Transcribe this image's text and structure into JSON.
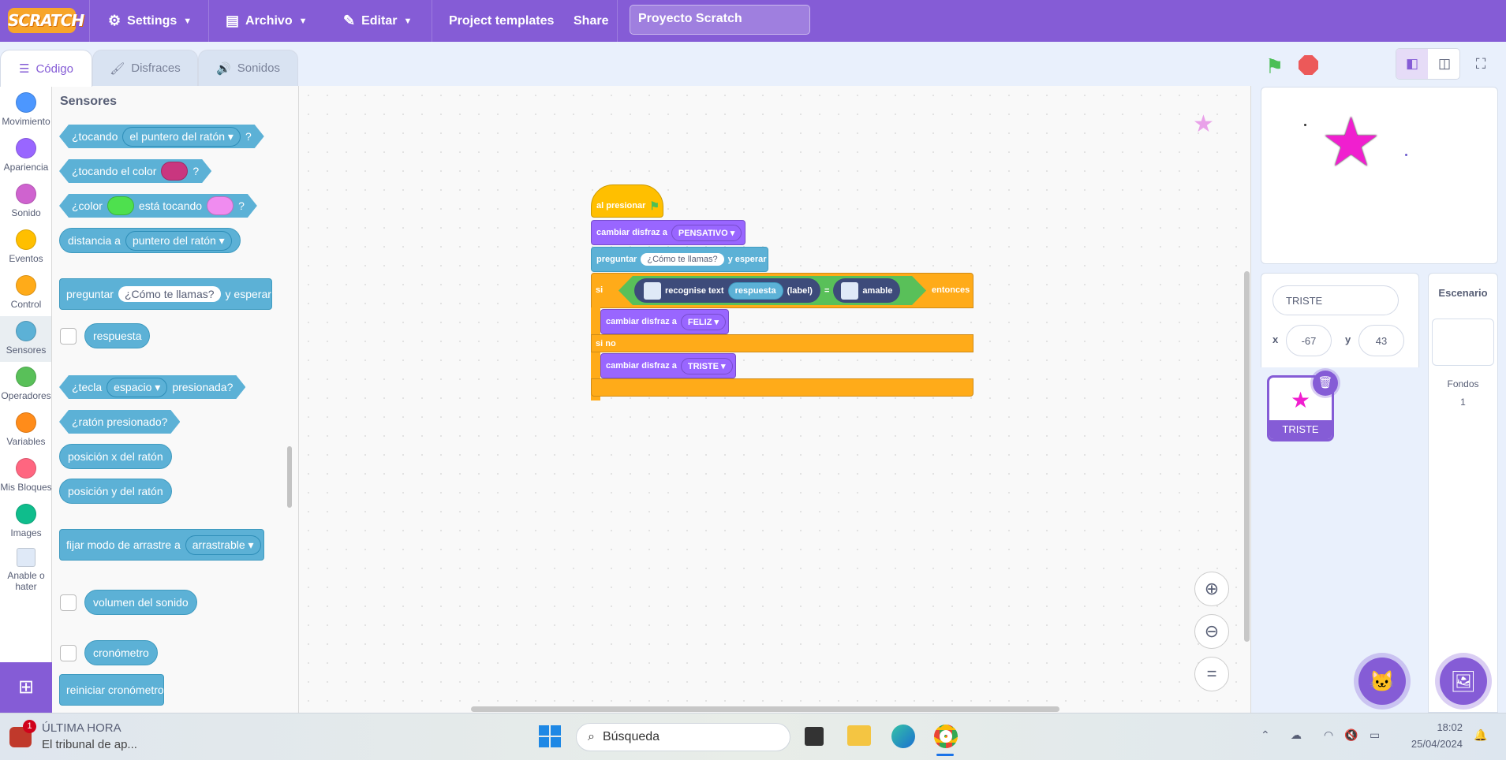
{
  "menu": {
    "logo": "SCRATCH",
    "settings": "Settings",
    "file": "Archivo",
    "edit": "Editar",
    "templates": "Project templates",
    "share": "Share",
    "project_title": "Proyecto Scratch",
    "accent": "#855cd6"
  },
  "tabs": {
    "code": "Código",
    "costumes": "Disfraces",
    "sounds": "Sonidos"
  },
  "categories": [
    {
      "label": "Movimiento",
      "color": "#4c97ff"
    },
    {
      "label": "Apariencia",
      "color": "#9966ff"
    },
    {
      "label": "Sonido",
      "color": "#cf63cf"
    },
    {
      "label": "Eventos",
      "color": "#ffbf00"
    },
    {
      "label": "Control",
      "color": "#ffab19"
    },
    {
      "label": "Sensores",
      "color": "#5cb1d6"
    },
    {
      "label": "Operadores",
      "color": "#59c059"
    },
    {
      "label": "Variables",
      "color": "#ff8c1a"
    },
    {
      "label": "Mis Bloques",
      "color": "#ff6680"
    },
    {
      "label": "Images",
      "color": "#0fbd8c"
    },
    {
      "label": "Anable o hater",
      "color": "#5b80c0"
    }
  ],
  "palette": {
    "title": "Sensores",
    "touching": "¿tocando",
    "touching_opt": "el puntero del ratón",
    "q": "?",
    "touching_color": "¿tocando el color",
    "color_is": "¿color",
    "is_touching": "está tocando",
    "distance_to": "distancia a",
    "distance_opt": "puntero del ratón",
    "ask": "preguntar",
    "ask_default": "¿Cómo te llamas?",
    "and_wait": "y esperar",
    "answer": "respuesta",
    "key": "¿tecla",
    "key_opt": "espacio",
    "pressed": "presionada?",
    "mouse_down": "¿ratón presionado?",
    "mouse_x": "posición x del ratón",
    "mouse_y": "posición y del ratón",
    "drag_mode": "fijar modo de arrastre a",
    "drag_opt": "arrastrable",
    "loudness": "volumen del sonido",
    "timer": "cronómetro",
    "reset_timer": "reiniciar cronómetro"
  },
  "script": {
    "when_flag": "al presionar",
    "switch_costume": "cambiar disfraz a",
    "costume_pensativo": "PENSATIVO",
    "ask": "preguntar",
    "ask_text": "¿Cómo te llamas?",
    "and_wait": "y esperar",
    "if": "si",
    "recognise": "recognise text",
    "answer": "respuesta",
    "label": "(label)",
    "equals": "=",
    "amable": "amable",
    "then": "entonces",
    "costume_feliz": "FELIZ",
    "else": "si no",
    "costume_triste": "TRISTE"
  },
  "sprite_info": {
    "name": "TRISTE",
    "x_label": "x",
    "x": "-67",
    "y_label": "y",
    "y": "43",
    "thumb_label": "TRISTE"
  },
  "stage_panel": {
    "title": "Escenario",
    "backdrops_label": "Fondos",
    "backdrops_count": "1"
  },
  "taskbar": {
    "news_badge": "1",
    "news_title": "ÚLTIMA HORA",
    "news_sub": "El tribunal de ap...",
    "search": "Búsqueda",
    "time": "18:02",
    "date": "25/04/2024"
  },
  "icons": [
    "gear-icon",
    "file-icon",
    "pencil-icon",
    "code-icon",
    "brush-icon",
    "speaker-icon",
    "green-flag-icon",
    "stop-icon",
    "small-stage-icon",
    "large-stage-icon",
    "fullscreen-icon",
    "zoom-in-icon",
    "zoom-out-icon",
    "zoom-reset-icon",
    "trash-icon",
    "add-sprite-icon",
    "add-backdrop-icon",
    "add-extension-icon"
  ]
}
